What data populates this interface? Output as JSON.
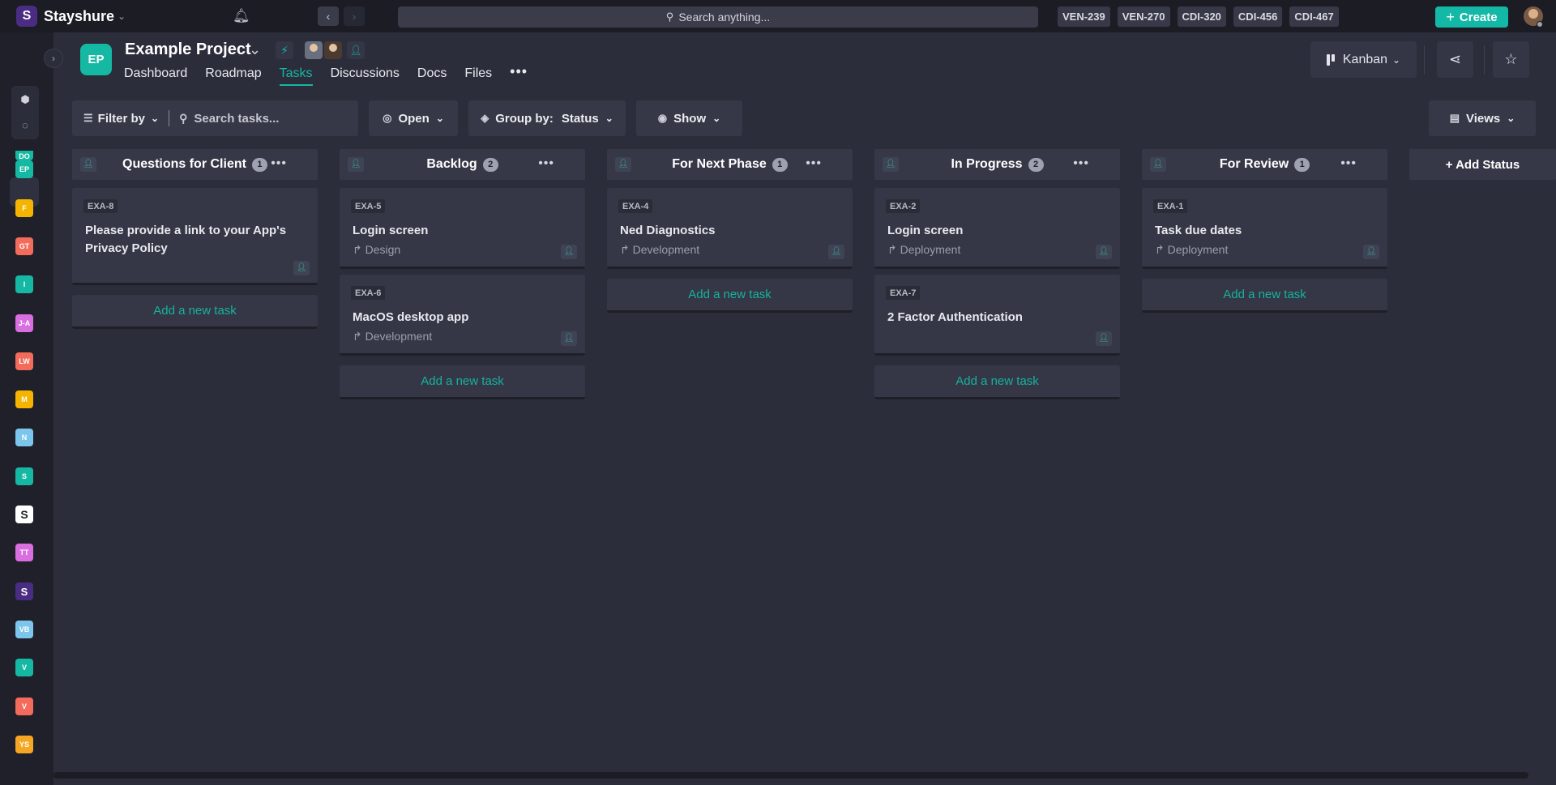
{
  "app": {
    "workspace": "Stayshure",
    "search_placeholder": "Search anything...",
    "recent_tickets": [
      "VEN-239",
      "VEN-270",
      "CDI-320",
      "CDI-456",
      "CDI-467"
    ],
    "create_label": "Create"
  },
  "rail": {
    "projects": [
      {
        "initials": "DO",
        "color": "#15b8a3"
      },
      {
        "initials": "EP",
        "color": "#15b8a3"
      },
      {
        "initials": "F",
        "color": "#f5b400"
      },
      {
        "initials": "GT",
        "color": "#f26b5b"
      },
      {
        "initials": "I",
        "color": "#15b8a3"
      },
      {
        "initials": "J-A",
        "color": "#d96ee0"
      },
      {
        "initials": "LW",
        "color": "#f26b5b"
      },
      {
        "initials": "M",
        "color": "#f5b400"
      },
      {
        "initials": "N",
        "color": "#7cc6ee"
      },
      {
        "initials": "S",
        "color": "#15b8a3"
      },
      {
        "initials": "S",
        "color": "#ffffff"
      },
      {
        "initials": "TT",
        "color": "#d96ee0"
      },
      {
        "initials": "S",
        "color": "#4a2c82"
      },
      {
        "initials": "VB",
        "color": "#7cc6ee"
      },
      {
        "initials": "V",
        "color": "#15b8a3"
      },
      {
        "initials": "V",
        "color": "#f26b5b"
      },
      {
        "initials": "YS",
        "color": "#f5a623"
      }
    ]
  },
  "project": {
    "badge": "EP",
    "title": "Example Project",
    "tabs": [
      "Dashboard",
      "Roadmap",
      "Tasks",
      "Discussions",
      "Docs",
      "Files"
    ],
    "active_tab": "Tasks",
    "more": "•••"
  },
  "header_actions": {
    "view": "Kanban",
    "views_label": "Views"
  },
  "filters": {
    "filter_by": "Filter by",
    "search_placeholder": "Search tasks...",
    "status_filter": "Open",
    "group_by_label": "Group by:",
    "group_by_value": "Status",
    "show_label": "Show"
  },
  "board": {
    "add_task_label": "Add a new task",
    "add_status_label": "+ Add Status",
    "columns": [
      {
        "title": "Questions for Client",
        "count": "1",
        "cards": [
          {
            "id": "EXA-8",
            "title": "Please provide a link to your App's Privacy Policy",
            "category": ""
          }
        ]
      },
      {
        "title": "Backlog",
        "count": "2",
        "cards": [
          {
            "id": "EXA-5",
            "title": "Login screen",
            "category": "Design"
          },
          {
            "id": "EXA-6",
            "title": "MacOS desktop app",
            "category": "Development"
          }
        ]
      },
      {
        "title": "For Next Phase",
        "count": "1",
        "cards": [
          {
            "id": "EXA-4",
            "title": "Ned Diagnostics",
            "category": "Development"
          }
        ]
      },
      {
        "title": "In Progress",
        "count": "2",
        "cards": [
          {
            "id": "EXA-2",
            "title": "Login screen",
            "category": "Deployment"
          },
          {
            "id": "EXA-7",
            "title": "2 Factor Authentication",
            "category": ""
          }
        ]
      },
      {
        "title": "For Review",
        "count": "1",
        "cards": [
          {
            "id": "EXA-1",
            "title": "Task due dates",
            "category": "Deployment"
          }
        ]
      }
    ]
  }
}
